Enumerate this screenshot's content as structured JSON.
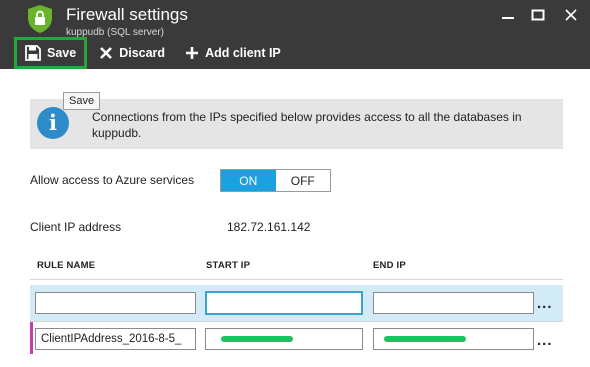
{
  "window": {
    "title": "Firewall settings",
    "subtitle": "kuppudb (SQL server)",
    "controls": [
      "minimize-icon",
      "maximize-icon",
      "close-icon"
    ]
  },
  "toolbar": {
    "save_label": "Save",
    "discard_label": "Discard",
    "add_client_ip_label": "Add client IP"
  },
  "tooltip": {
    "text": "Save"
  },
  "info": {
    "icon": "info-icon",
    "text": "Connections from the IPs specified below provides access to all the databases in kuppudb."
  },
  "azure_services": {
    "label": "Allow access to Azure services",
    "on_label": "ON",
    "off_label": "OFF",
    "selected": "ON"
  },
  "client_ip": {
    "label": "Client IP address",
    "value": "182.72.161.142"
  },
  "rules_table": {
    "columns": [
      "RULE NAME",
      "START IP",
      "END IP"
    ],
    "rows": [
      {
        "rule_name": "",
        "start_ip": "",
        "end_ip": "",
        "more": "..."
      },
      {
        "rule_name": "ClientIPAddress_2016-8-5_",
        "start_ip": "",
        "end_ip": "",
        "more": "..."
      }
    ]
  },
  "colors": {
    "header_bg": "#3a3a3a",
    "save_highlight": "#22a93a",
    "toggle_on": "#1ba1e2",
    "info_icon": "#2e8bc9",
    "selected_row": "#d2ebf6",
    "row_marker": "#c13fae",
    "redaction": "#20c060"
  }
}
